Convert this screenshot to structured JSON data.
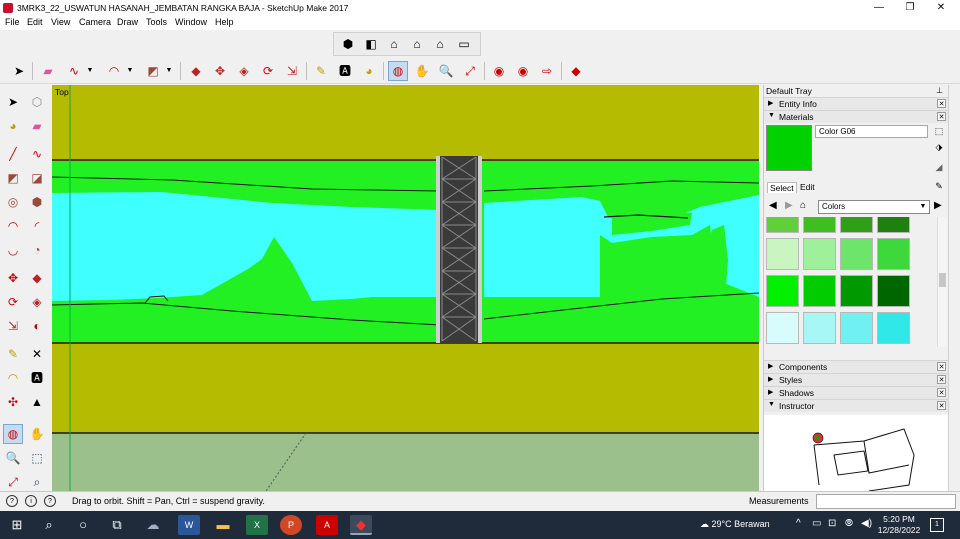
{
  "window": {
    "title": "3MRK3_22_USWATUN HASANAH_JEMBATAN RANGKA BAJA - SketchUp Make 2017",
    "minimize": "—",
    "maximize": "❐",
    "close": "✕"
  },
  "menu": [
    "File",
    "Edit",
    "View",
    "Camera",
    "Draw",
    "Tools",
    "Window",
    "Help"
  ],
  "viewport": {
    "view_label": "Top",
    "colors": {
      "ground": "#b5bb00",
      "grass": "#22f022",
      "water": "#40ffff",
      "lower_ground": "#9cc08c",
      "bridge": "#3a3a3a"
    }
  },
  "tray": {
    "title": "Default Tray",
    "pin": "📌",
    "entity_info": "Entity Info",
    "materials": "Materials",
    "material_name": "Color G06",
    "material_color": "#00d200",
    "tab_select": "Select",
    "tab_edit": "Edit",
    "collection": "Colors",
    "swatch_colors": [
      "#5fcf3a",
      "#3fbf1f",
      "#2f9f17",
      "#1f7f0f",
      "#c8f5c0",
      "#9ef09a",
      "#6de46a",
      "#3fd83c",
      "#00f000",
      "#00cc00",
      "#009900",
      "#006600",
      "#d8fbfb",
      "#a8f7f7",
      "#70f0f0",
      "#30e8e8",
      "#00f8f8",
      "#00c8c8",
      "#009898",
      "#006868"
    ],
    "components": "Components",
    "styles": "Styles",
    "shadows": "Shadows",
    "instructor": "Instructor"
  },
  "status": {
    "hint": "Drag to orbit. Shift = Pan, Ctrl = suspend gravity.",
    "measurements_label": "Measurements",
    "measurements_value": ""
  },
  "taskbar": {
    "weather": "29°C  Berawan",
    "time": "5:20 PM",
    "date": "12/28/2022",
    "notifications": "1"
  }
}
